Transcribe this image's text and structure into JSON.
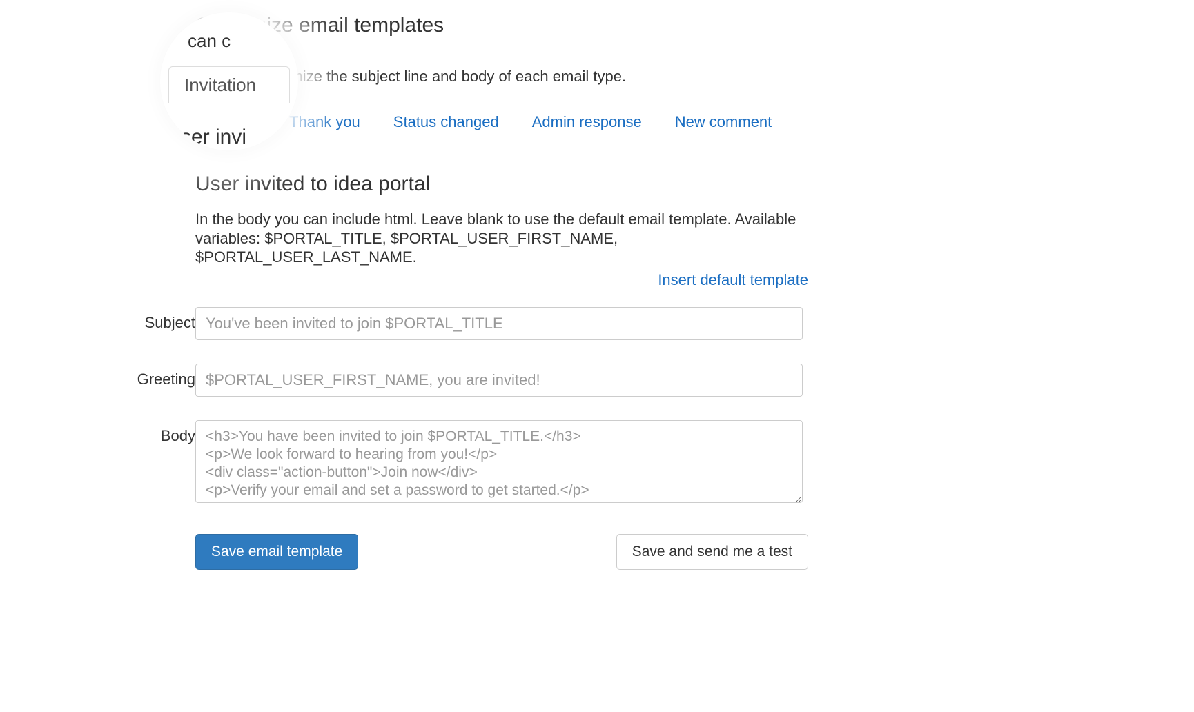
{
  "header": {
    "title": "Customize email templates",
    "description": "You can customize the subject line and body of each email type."
  },
  "tabs": {
    "items": [
      {
        "label": "Invitation",
        "active": true
      },
      {
        "label": "Thank you",
        "active": false
      },
      {
        "label": "Status changed",
        "active": false
      },
      {
        "label": "Admin response",
        "active": false
      },
      {
        "label": "New comment",
        "active": false
      }
    ]
  },
  "magnifier": {
    "active_tab_label": "Invitation",
    "trunc_top": "can c",
    "trunc_bottom": "ser invi"
  },
  "section": {
    "heading": "User invited to idea portal",
    "description": "In the body you can include html. Leave blank to use the default email template. Available variables: $PORTAL_TITLE, $PORTAL_USER_FIRST_NAME, $PORTAL_USER_LAST_NAME.",
    "insert_default_link": "Insert default template"
  },
  "form": {
    "subject": {
      "label": "Subject",
      "placeholder": "You've been invited to join $PORTAL_TITLE",
      "value": ""
    },
    "greeting": {
      "label": "Greeting",
      "placeholder": "$PORTAL_USER_FIRST_NAME, you are invited!",
      "value": ""
    },
    "body": {
      "label": "Body",
      "placeholder": "<h3>You have been invited to join $PORTAL_TITLE.</h3>\n<p>We look forward to hearing from you!</p>\n<div class=\"action-button\">Join now</div>\n<p>Verify your email and set a password to get started.</p>",
      "value": ""
    }
  },
  "buttons": {
    "save": "Save email template",
    "save_test": "Save and send me a test"
  }
}
